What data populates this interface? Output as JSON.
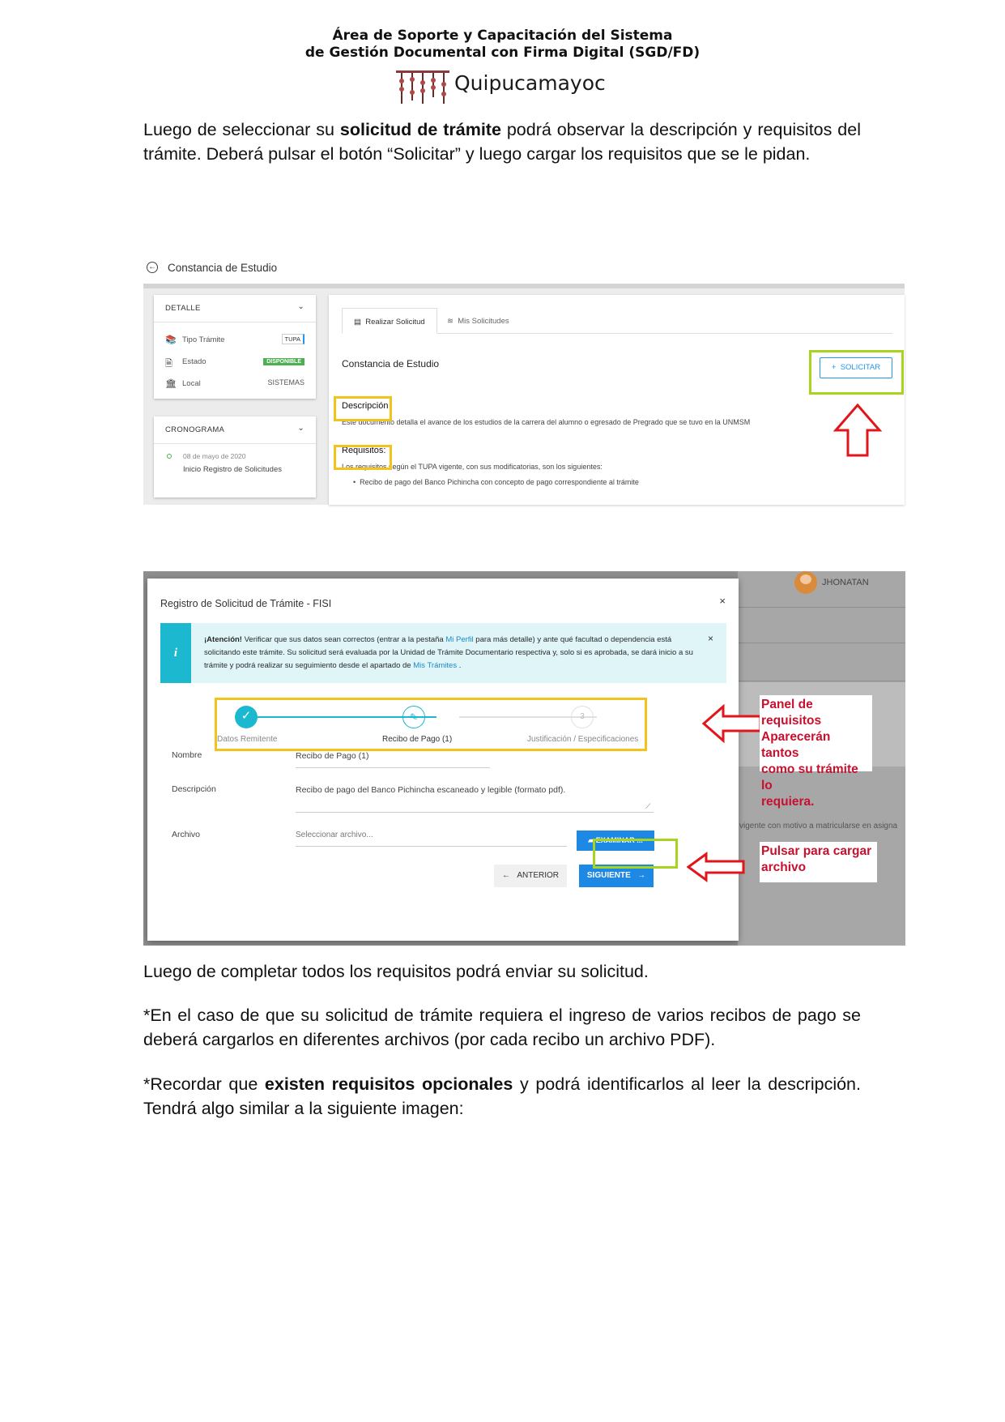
{
  "header": {
    "line1": "Área de Soporte y Capacitación del Sistema",
    "line2": "de Gestión Documental con Firma Digital (SGD/FD)",
    "logo_text": "Quipucamayoc"
  },
  "para1": {
    "a": "Luego de seleccionar su ",
    "b": "solicitud de trámite",
    "c": " podrá observar la descripción y requisitos del trámite. Deberá pulsar el botón “Solicitar” y luego cargar los requisitos que se le pidan."
  },
  "shot1": {
    "page_title": "Constancia de Estudio",
    "detalle": {
      "header": "DETALLE",
      "rows": [
        {
          "label": "Tipo Trámite",
          "value": "TUPA"
        },
        {
          "label": "Estado",
          "value": "DISPONIBLE"
        },
        {
          "label": "Local",
          "value": "SISTEMAS"
        }
      ]
    },
    "cronograma": {
      "header": "CRONOGRAMA",
      "date": "08 de mayo de 2020",
      "event": "Inicio Registro de Solicitudes"
    },
    "tabs": [
      "Realizar Solicitud",
      "Mis Solicitudes"
    ],
    "main_title": "Constancia de Estudio",
    "solicitar_label": "SOLICITAR",
    "descripcion_label": "Descripción",
    "descripcion_text": "Este documento detalla el avance de los estudios de la carrera del alumno o egresado de Pregrado que se tuvo en la UNMSM",
    "requisitos_label": "Requisitos:",
    "requisitos_intro": "Los requisitos según el TUPA vigente, con sus modificatorias, son los siguientes:",
    "requisitos_item": "Recibo de pago del Banco Pichincha con concepto de pago correspondiente al trámite"
  },
  "shot2": {
    "user_name": "JHONATAN",
    "modal_title": "Registro de Solicitud de Trámite - FISI",
    "alert": {
      "bold": "¡Atención!",
      "t1": " Verificar que sus datos sean correctos (entrar a la pestaña ",
      "link1": "Mi Perfil",
      "t2": " para más detalle) y ante qué facultad o dependencia está solicitando este trámite. Su solicitud será evaluada por la Unidad de Trámite Documentario respectiva y, solo si es aprobada, se dará inicio a su trámite y podrá realizar su seguimiento desde el apartado de ",
      "link2": "Mis Trámites",
      "t3": " ."
    },
    "steps": [
      {
        "label": "Datos Remitente",
        "num": ""
      },
      {
        "label": "Recibo de Pago (1)",
        "num": ""
      },
      {
        "label": "Justificación / Especificaciones",
        "num": "3"
      }
    ],
    "form": {
      "nombre_label": "Nombre",
      "nombre_value": "Recibo de Pago (1)",
      "descripcion_label": "Descripción",
      "descripcion_value": "Recibo de pago del Banco Pichincha escaneado y legible (formato pdf).",
      "archivo_label": "Archivo",
      "archivo_placeholder": "Seleccionar archivo..."
    },
    "examinar_label": "EXAMINAR ...",
    "anterior_label": "ANTERIOR",
    "siguiente_label": "SIGUIENTE",
    "bg_text": "vigente con motivo a matricularse en asigna",
    "note1": [
      "Panel de requisitos",
      "Aparecerán tantos",
      "como su trámite lo",
      "requiera."
    ],
    "note2": [
      "Pulsar para cargar",
      "archivo"
    ]
  },
  "para2": "Luego de completar todos los requisitos podrá enviar su solicitud.",
  "para3": "*En el caso de que su solicitud de trámite requiera el ingreso de varios recibos de pago se deberá cargarlos en diferentes archivos (por cada recibo un archivo PDF).",
  "para4": {
    "a": "*Recordar que ",
    "b": "existen requisitos opcionales",
    "c": " y podrá identificarlos al leer la descripción. Tendrá algo similar a la siguiente imagen:"
  },
  "colors": {
    "highlight_green": "#a8d31f",
    "highlight_yellow": "#f2c31b",
    "arrow_red": "#e0161b",
    "primary_blue": "#1e88e5",
    "teal": "#1bb8cf"
  }
}
